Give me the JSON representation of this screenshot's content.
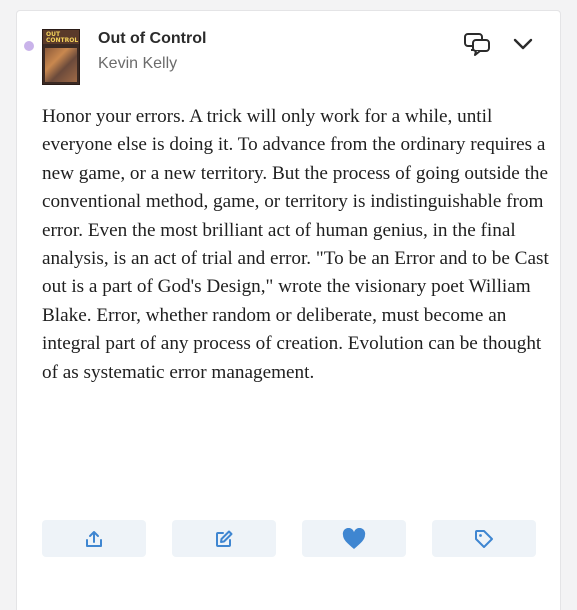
{
  "highlight": {
    "book_title": "Out of Control",
    "author": "Kevin Kelly",
    "cover": {
      "title_line1": "OUT",
      "title_line2": "CONTROL"
    },
    "quote": "Honor your errors. A trick will only work for a while, until everyone else is doing it. To advance from the ordinary requires a new game, or a new territory. But the process of going outside the conventional method, game, or territory is indistinguishable from error. Even the most brilliant act of human genius, in the final analysis, is an act of trial and error. \"To be an Error and to be Cast out is a part of God's Design,\" wrote the visionary poet William Blake. Error, whether random or deliberate, must become an integral part of any process of creation. Evolution can be thought of as systematic error management."
  },
  "header_actions": [
    {
      "icon": "chat-bubbles-icon"
    },
    {
      "icon": "chevron-down-icon"
    }
  ],
  "actions": [
    {
      "icon": "share-icon"
    },
    {
      "icon": "edit-icon"
    },
    {
      "icon": "heart-icon",
      "active": true
    },
    {
      "icon": "tag-icon"
    }
  ],
  "colors": {
    "accent": "#3f86d1",
    "action_bg": "#eef3f8",
    "dot": "#c9b3ea",
    "text": "#1f1f1f",
    "muted": "#6b6b6b"
  }
}
